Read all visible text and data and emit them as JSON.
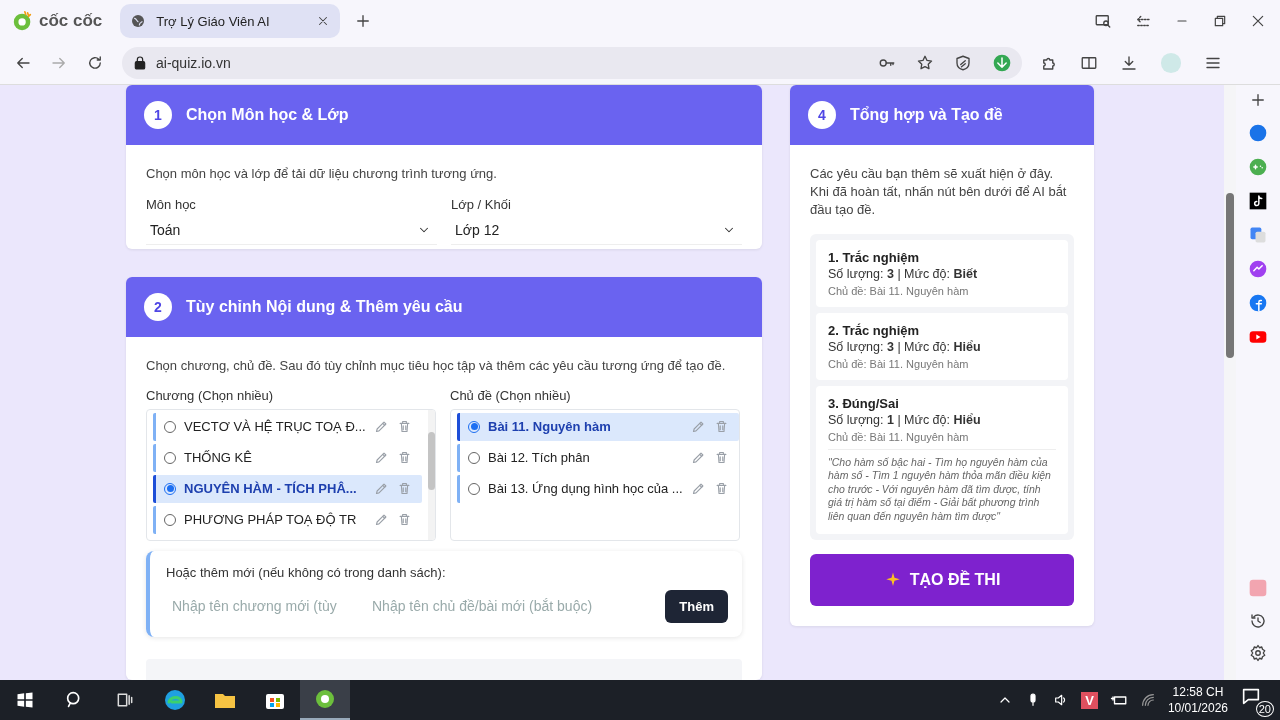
{
  "browser": {
    "brand": "cốc cốc",
    "tab_title": "Trợ Lý Giáo Viên AI",
    "url": "ai-quiz.io.vn"
  },
  "step1": {
    "number": "1",
    "title": "Chọn Môn học & Lớp",
    "description": "Chọn môn học và lớp để tải dữ liệu chương trình tương ứng.",
    "fields": [
      {
        "label": "Môn học",
        "value": "Toán"
      },
      {
        "label": "Lớp / Khối",
        "value": "Lớp 12"
      }
    ]
  },
  "step2": {
    "number": "2",
    "title": "Tùy chỉnh Nội dung & Thêm yêu cầu",
    "description": "Chọn chương, chủ đề. Sau đó tùy chỉnh mục tiêu học tập và thêm các yêu cầu tương ứng để tạo đề.",
    "chapters_label": "Chương (Chọn nhiều)",
    "chapters": [
      {
        "name": "VECTƠ VÀ HỆ TRỤC TOẠ Đ...",
        "selected": false
      },
      {
        "name": "THỐNG KÊ",
        "selected": false
      },
      {
        "name": "NGUYÊN HÀM - TÍCH PHÂ...",
        "selected": true
      },
      {
        "name": "PHƯƠNG PHÁP TOẠ ĐỘ TR",
        "selected": false
      }
    ],
    "topics_label": "Chủ đề (Chọn nhiều)",
    "topics": [
      {
        "name": "Bài 11. Nguyên hàm",
        "selected": true
      },
      {
        "name": "Bài 12. Tích phân",
        "selected": false
      },
      {
        "name": "Bài 13. Ứng dụng hình học của ...",
        "selected": false
      }
    ],
    "add_new": {
      "label": "Hoặc thêm mới (nếu không có trong danh sách):",
      "chapter_placeholder": "Nhập tên chương mới (tùy",
      "topic_placeholder": "Nhập tên chủ đề/bài mới (bắt buộc)",
      "button": "Thêm"
    }
  },
  "step4": {
    "number": "4",
    "title": "Tổng hợp và Tạo đề",
    "description": "Các yêu cầu bạn thêm sẽ xuất hiện ở đây. Khi đã hoàn tất, nhấn nút bên dưới để AI bắt đầu tạo đề.",
    "requests": [
      {
        "title": "1. Trắc nghiệm",
        "summary": "Số lượng: **3** | Mức độ: **Biết**",
        "topic": "Chủ đề: Bài 11. Nguyên hàm"
      },
      {
        "title": "2. Trắc nghiệm",
        "summary": "Số lượng: **3** | Mức độ: **Hiểu**",
        "topic": "Chủ đề: Bài 11. Nguyên hàm"
      },
      {
        "title": "3. Đúng/Sai",
        "summary": "Số lượng: **1** | Mức độ: **Hiểu**",
        "topic": "Chủ đề: Bài 11. Nguyên hàm",
        "note": "\"Cho hàm số bậc hai - Tìm họ nguyên hàm của hàm số - Tìm 1 nguyên hàm thỏa mãn điều kiện cho trước - Với nguyên hàm đã tìm được, tính giá trị hàm số tại điểm - Giải bất phương trình liên quan đến nguyên hàm tìm được\""
      }
    ],
    "create_button": "TẠO ĐỀ THI"
  },
  "taskbar": {
    "tray_badge": "V",
    "time": "12:58 CH",
    "date": "10/01/2026",
    "notifications": "20"
  }
}
